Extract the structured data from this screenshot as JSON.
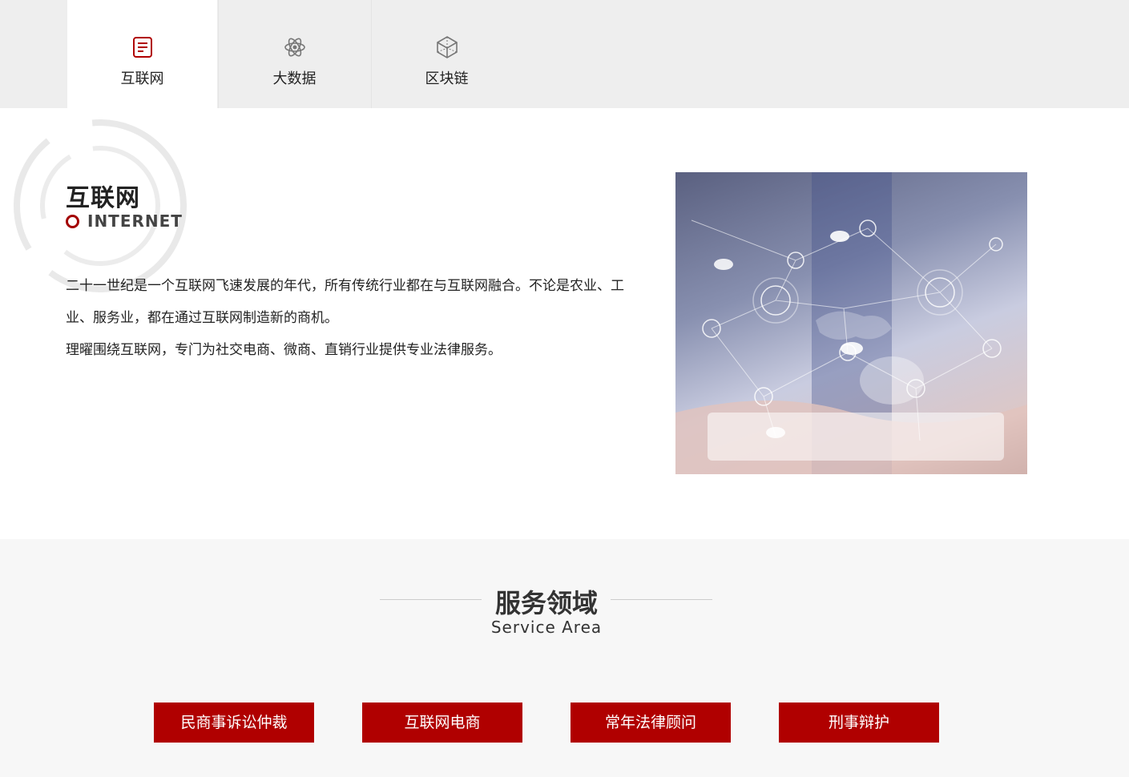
{
  "tabs": [
    {
      "label": "互联网",
      "icon": "document-list-icon",
      "active": true
    },
    {
      "label": "大数据",
      "icon": "atom-icon",
      "active": false
    },
    {
      "label": "区块链",
      "icon": "blockchain-cube-icon",
      "active": false
    }
  ],
  "intro": {
    "title": "互联网",
    "subtitle": "INTERNET",
    "paragraphs": [
      "二十一世纪是一个互联网飞速发展的年代，所有传统行业都在与互联网融合。不论是农业、工业、服务业，都在通过互联网制造新的商机。",
      "理曜围绕互联网，专门为社交电商、微商、直销行业提供专业法律服务。"
    ]
  },
  "service": {
    "title": "服务领域",
    "subtitle": "Service Area",
    "buttons": [
      "民商事诉讼仲裁",
      "互联网电商",
      "常年法律顾问",
      "刑事辩护"
    ]
  },
  "colors": {
    "accent": "#b00000",
    "tab_bar": "#eeeeee",
    "service_bg": "#f7f7f7"
  }
}
